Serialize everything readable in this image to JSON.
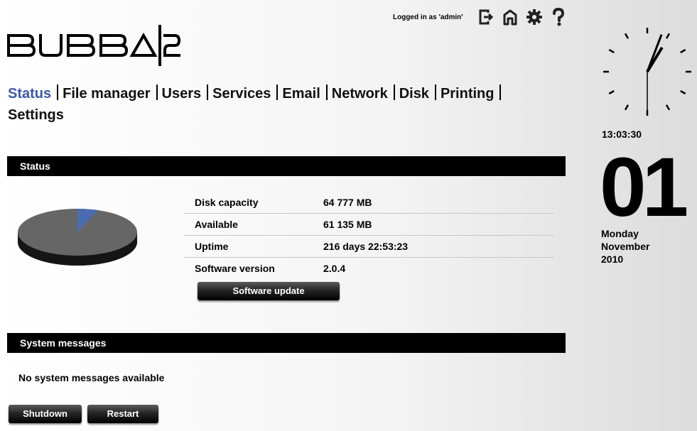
{
  "logo": {
    "text": "BUBBA|2"
  },
  "topbar": {
    "logged_in": "Logged in as 'admin'",
    "icons": [
      "logout-icon",
      "home-icon",
      "settings-gear-icon",
      "help-icon"
    ]
  },
  "nav": {
    "items": [
      "Status",
      "File manager",
      "Users",
      "Services",
      "Email",
      "Network",
      "Disk",
      "Printing",
      "Settings"
    ],
    "active": "Status",
    "active_color": "#3a59a8"
  },
  "status_section": {
    "title": "Status",
    "pie": {
      "used_fraction": 0.056,
      "used_color": "#4a6cb0",
      "free_color": "#666666"
    },
    "rows": [
      {
        "label": "Disk capacity",
        "value": "64 777 MB"
      },
      {
        "label": "Available",
        "value": "61 135 MB"
      },
      {
        "label": "Uptime",
        "value": "216 days 22:53:23"
      },
      {
        "label": "Software version",
        "value": "2.0.4"
      }
    ],
    "update_button": "Software update"
  },
  "messages_section": {
    "title": "System messages",
    "empty_text": "No system messages available"
  },
  "buttons": {
    "shutdown": "Shutdown",
    "restart": "Restart"
  },
  "clock": {
    "time": "13:03:30",
    "day_number": "01",
    "weekday": "Monday",
    "month": "November",
    "year": "2010"
  }
}
